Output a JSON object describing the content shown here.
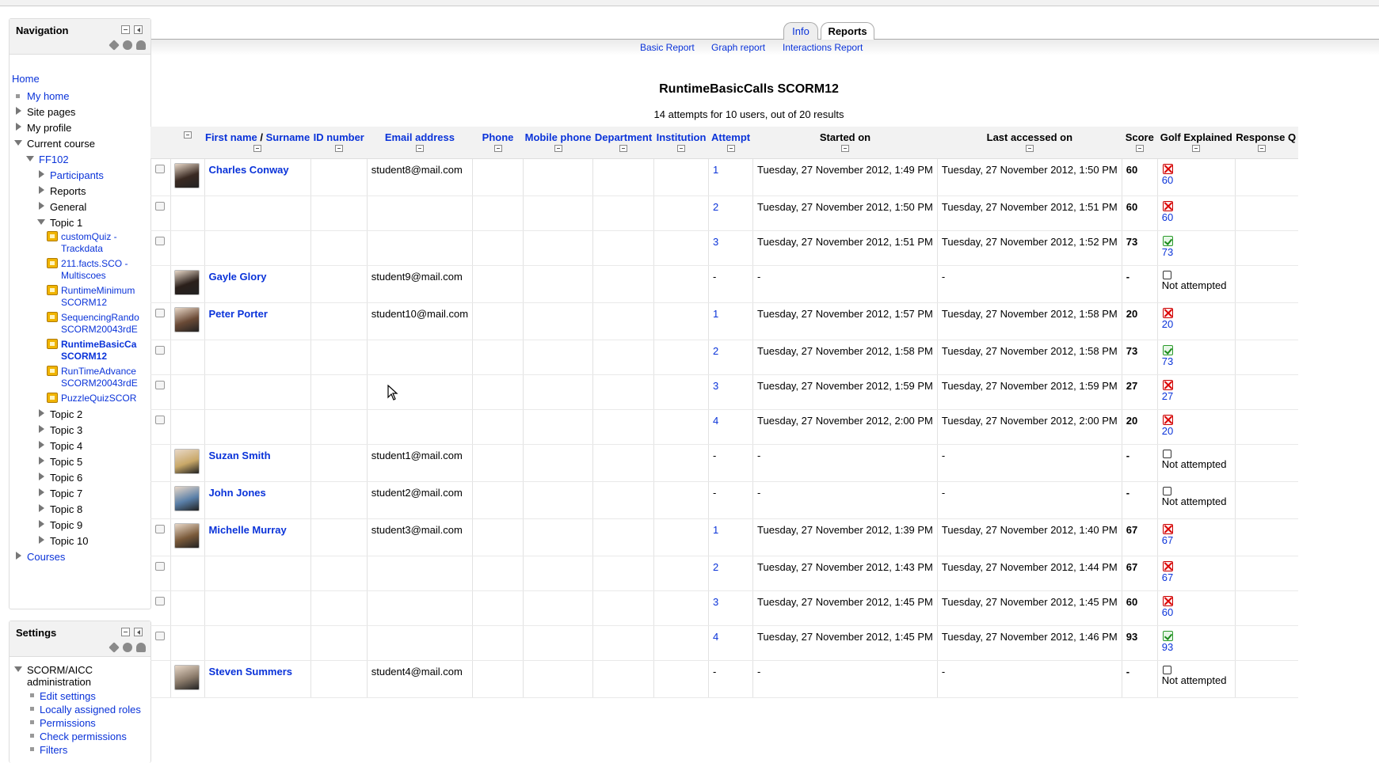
{
  "navigation": {
    "title": "Navigation",
    "home": "Home",
    "my_home": "My home",
    "site_pages": "Site pages",
    "my_profile": "My profile",
    "current_course": "Current course",
    "course": "FF102",
    "participants": "Participants",
    "reports": "Reports",
    "general": "General",
    "topic1": "Topic 1",
    "activities": [
      {
        "line1": "customQuiz -",
        "line2": "Trackdata"
      },
      {
        "line1": "211.facts.SCO -",
        "line2": "Multiscoes"
      },
      {
        "line1": "RuntimeMinimum",
        "line2": "SCORM12"
      },
      {
        "line1": "SequencingRando",
        "line2": "SCORM20043rdE"
      },
      {
        "line1": "RuntimeBasicCa",
        "line2": "SCORM12"
      },
      {
        "line1": "RunTimeAdvance",
        "line2": "SCORM20043rdE"
      },
      {
        "line1": "PuzzleQuizSCOR",
        "line2": ""
      }
    ],
    "topics": [
      "Topic 2",
      "Topic 3",
      "Topic 4",
      "Topic 5",
      "Topic 6",
      "Topic 7",
      "Topic 8",
      "Topic 9",
      "Topic 10"
    ],
    "courses": "Courses"
  },
  "settings": {
    "title": "Settings",
    "section_line1": "SCORM/AICC",
    "section_line2": "administration",
    "items": [
      "Edit settings",
      "Locally assigned roles",
      "Permissions",
      "Check permissions",
      "Filters"
    ]
  },
  "tabs": {
    "info": "Info",
    "reports": "Reports"
  },
  "subtabs": {
    "basic": "Basic Report",
    "graph": "Graph report",
    "interactions": "Interactions Report"
  },
  "report": {
    "title": "RuntimeBasicCalls SCORM12",
    "summary": "14 attempts for 10 users, out of 20 results"
  },
  "table": {
    "headers": {
      "first_name": "First name",
      "sep": " / ",
      "surname": "Surname",
      "id_number": "ID number",
      "email": "Email address",
      "phone": "Phone",
      "mobile": "Mobile phone",
      "department": "Department",
      "institution": "Institution",
      "attempt": "Attempt",
      "started": "Started on",
      "last": "Last accessed on",
      "score": "Score",
      "golf": "Golf Explained",
      "response": "Response Q"
    },
    "rows": [
      {
        "name": "Charles Conway",
        "email": "student8@mail.com",
        "attempt": "1",
        "started": "Tuesday, 27 November 2012, 1:49 PM",
        "last": "Tuesday, 27 November 2012, 1:50 PM",
        "score": "60",
        "status": "fail",
        "golf": "60",
        "avatar": "#3a2a22"
      },
      {
        "name": "",
        "email": "",
        "attempt": "2",
        "started": "Tuesday, 27 November 2012, 1:50 PM",
        "last": "Tuesday, 27 November 2012, 1:51 PM",
        "score": "60",
        "status": "fail",
        "golf": "60",
        "avatar": ""
      },
      {
        "name": "",
        "email": "",
        "attempt": "3",
        "started": "Tuesday, 27 November 2012, 1:51 PM",
        "last": "Tuesday, 27 November 2012, 1:52 PM",
        "score": "73",
        "status": "pass",
        "golf": "73",
        "avatar": ""
      },
      {
        "name": "Gayle Glory",
        "email": "student9@mail.com",
        "attempt": "-",
        "started": "-",
        "last": "-",
        "score": "-",
        "status": "none",
        "golf": "Not attempted",
        "avatar": "#2a1f1a"
      },
      {
        "name": "Peter Porter",
        "email": "student10@mail.com",
        "attempt": "1",
        "started": "Tuesday, 27 November 2012, 1:57 PM",
        "last": "Tuesday, 27 November 2012, 1:58 PM",
        "score": "20",
        "status": "fail",
        "golf": "20",
        "avatar": "#6a4a36"
      },
      {
        "name": "",
        "email": "",
        "attempt": "2",
        "started": "Tuesday, 27 November 2012, 1:58 PM",
        "last": "Tuesday, 27 November 2012, 1:58 PM",
        "score": "73",
        "status": "pass",
        "golf": "73",
        "avatar": ""
      },
      {
        "name": "",
        "email": "",
        "attempt": "3",
        "started": "Tuesday, 27 November 2012, 1:59 PM",
        "last": "Tuesday, 27 November 2012, 1:59 PM",
        "score": "27",
        "status": "fail",
        "golf": "27",
        "avatar": ""
      },
      {
        "name": "",
        "email": "",
        "attempt": "4",
        "started": "Tuesday, 27 November 2012, 2:00 PM",
        "last": "Tuesday, 27 November 2012, 2:00 PM",
        "score": "20",
        "status": "fail",
        "golf": "20",
        "avatar": ""
      },
      {
        "name": "Suzan Smith",
        "email": "student1@mail.com",
        "attempt": "-",
        "started": "-",
        "last": "-",
        "score": "-",
        "status": "none",
        "golf": "Not attempted",
        "avatar": "#c9a868"
      },
      {
        "name": "John Jones",
        "email": "student2@mail.com",
        "attempt": "-",
        "started": "-",
        "last": "-",
        "score": "-",
        "status": "none",
        "golf": "Not attempted",
        "avatar": "#5a7fa8"
      },
      {
        "name": "Michelle Murray",
        "email": "student3@mail.com",
        "attempt": "1",
        "started": "Tuesday, 27 November 2012, 1:39 PM",
        "last": "Tuesday, 27 November 2012, 1:40 PM",
        "score": "67",
        "status": "fail",
        "golf": "67",
        "avatar": "#7a5a3a"
      },
      {
        "name": "",
        "email": "",
        "attempt": "2",
        "started": "Tuesday, 27 November 2012, 1:43 PM",
        "last": "Tuesday, 27 November 2012, 1:44 PM",
        "score": "67",
        "status": "fail",
        "golf": "67",
        "avatar": ""
      },
      {
        "name": "",
        "email": "",
        "attempt": "3",
        "started": "Tuesday, 27 November 2012, 1:45 PM",
        "last": "Tuesday, 27 November 2012, 1:45 PM",
        "score": "60",
        "status": "fail",
        "golf": "60",
        "avatar": ""
      },
      {
        "name": "",
        "email": "",
        "attempt": "4",
        "started": "Tuesday, 27 November 2012, 1:45 PM",
        "last": "Tuesday, 27 November 2012, 1:46 PM",
        "score": "93",
        "status": "pass",
        "golf": "93",
        "avatar": ""
      },
      {
        "name": "Steven Summers",
        "email": "student4@mail.com",
        "attempt": "-",
        "started": "-",
        "last": "-",
        "score": "-",
        "status": "none",
        "golf": "Not attempted",
        "avatar": "#8a7a6a"
      }
    ]
  }
}
